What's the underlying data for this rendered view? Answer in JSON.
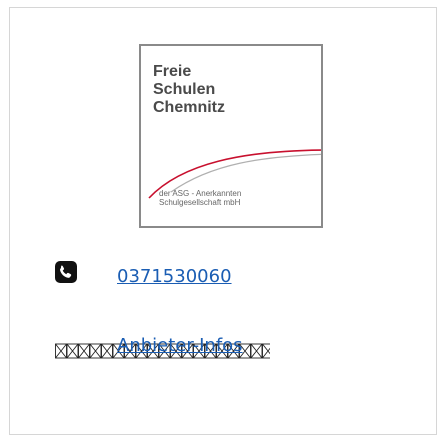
{
  "logo": {
    "title_line1": "Freie",
    "title_line2": "Schulen",
    "title_line3": "Chemnitz",
    "sub_line1": "der ASG - Anerkannten",
    "sub_line2": "Schulgesellschaft mbH",
    "accent_color": "#c8102e"
  },
  "contact": {
    "phone_icon": "phone-icon",
    "phone_number": "0371530060"
  },
  "links": {
    "info_label": "Anbieter-Infos"
  },
  "colors": {
    "link": "#1a5db3",
    "border": "#d6d6d6"
  }
}
